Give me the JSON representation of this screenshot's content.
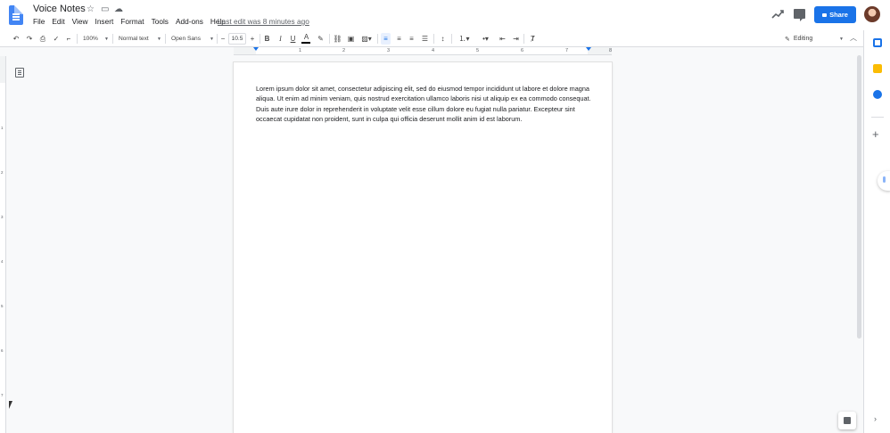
{
  "app": {
    "title": "Voice Notes"
  },
  "menu": [
    "File",
    "Edit",
    "View",
    "Insert",
    "Format",
    "Tools",
    "Add-ons",
    "Help"
  ],
  "last_edit": "Last edit was 8 minutes ago",
  "header": {
    "share_label": "Share"
  },
  "toolbar": {
    "zoom": "100%",
    "style": "Normal text",
    "font": "Open Sans",
    "font_size": "10.5",
    "minus": "−",
    "plus": "+",
    "bold": "B",
    "italic": "I",
    "underline": "U",
    "text_color": "A",
    "mode": "Editing"
  },
  "ruler": {
    "numbers": [
      "1",
      "2",
      "3",
      "4",
      "5",
      "6",
      "7",
      "8"
    ],
    "vertical_numbers": [
      "1",
      "2",
      "3",
      "4",
      "5",
      "6",
      "7"
    ]
  },
  "document": {
    "body": "Lorem ipsum dolor sit amet, consectetur adipiscing elit, sed do eiusmod tempor incididunt ut labore et dolore magna aliqua. Ut enim ad minim veniam, quis nostrud exercitation ullamco laboris nisi ut aliquip ex ea commodo consequat. Duis aute irure dolor in reprehenderit in voluptate velit esse cillum dolore eu fugiat nulla pariatur. Excepteur sint occaecat cupidatat non proident, sunt in culpa qui officia deserunt mollit anim id est laborum."
  },
  "colors": {
    "accent": "#1a73e8",
    "calendar": "#1a73e8",
    "keep": "#fbbc04",
    "tasks": "#1a73e8"
  }
}
